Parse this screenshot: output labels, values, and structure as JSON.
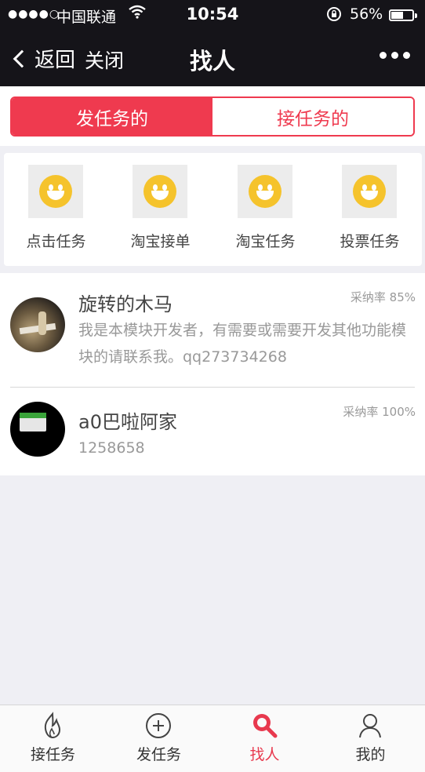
{
  "status_bar": {
    "signal": "●●●●○",
    "carrier": "中国联通",
    "wifi_icon": "wifi-icon",
    "time": "10:54",
    "battery_percent": "56%",
    "battery_level": 0.56
  },
  "nav": {
    "back_label": "返回",
    "close_label": "关闭",
    "title": "找人",
    "more_icon": "more-dots-icon"
  },
  "segment_tabs": [
    {
      "label": "发任务的",
      "active": true
    },
    {
      "label": "接任务的",
      "active": false
    }
  ],
  "grid": {
    "items": [
      {
        "label": "点击任务",
        "icon": "smiley-icon"
      },
      {
        "label": "淘宝接单",
        "icon": "smiley-icon"
      },
      {
        "label": "淘宝任务",
        "icon": "smiley-icon"
      },
      {
        "label": "投票任务",
        "icon": "smiley-icon"
      }
    ]
  },
  "list": [
    {
      "name": "旋转的木马",
      "rate": "采纳率 85%",
      "desc": "我是本模块开发者，有需要或需要开发其他功能模块的请联系我。qq273734268"
    },
    {
      "name": "a0巴啦阿家",
      "rate": "采纳率 100%",
      "desc": "1258658"
    }
  ],
  "tabbar": {
    "items": [
      {
        "label": "接任务",
        "icon": "flame-icon",
        "active": false
      },
      {
        "label": "发任务",
        "icon": "plus-circle-icon",
        "active": false
      },
      {
        "label": "找人",
        "icon": "search-icon",
        "active": true
      },
      {
        "label": "我的",
        "icon": "person-icon",
        "active": false
      }
    ]
  },
  "colors": {
    "accent": "#ef3a4f",
    "topbar": "#151419",
    "background": "#efeff4",
    "smiley": "#f5c32c"
  }
}
